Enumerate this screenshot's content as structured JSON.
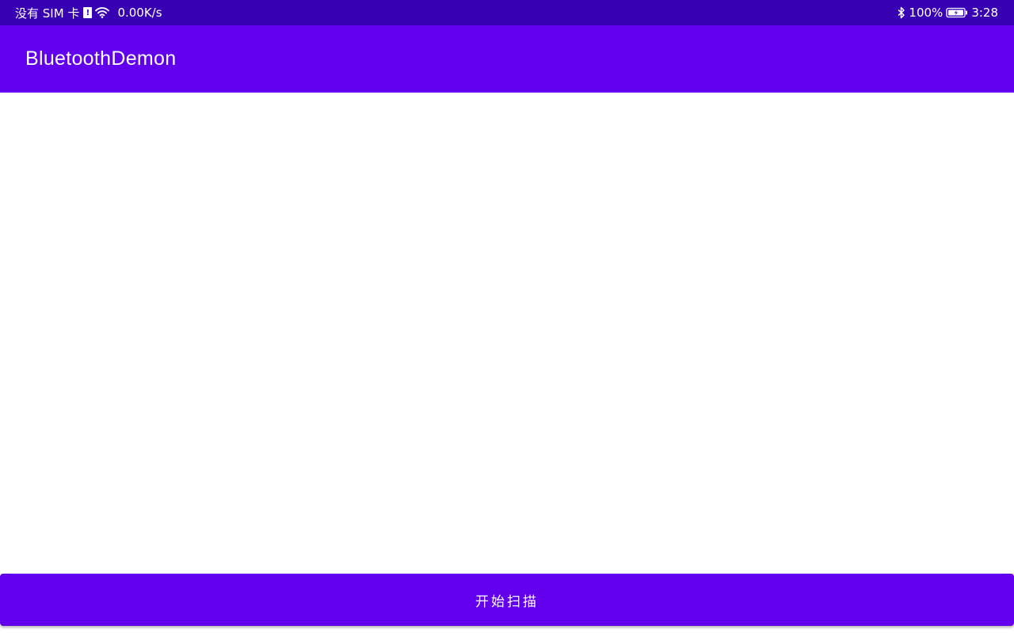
{
  "status_bar": {
    "sim_text": "没有 SIM 卡",
    "sim_alert_glyph": "!",
    "net_speed": "0.00K/s",
    "battery_percent": "100%",
    "time": "3:28",
    "icons": [
      "sim-alert-icon",
      "wifi-icon",
      "bluetooth-icon",
      "battery-charging-icon"
    ]
  },
  "app_bar": {
    "title": "BluetoothDemon"
  },
  "actions": {
    "scan_label": "开始扫描"
  },
  "colors": {
    "status_bar": "#3700b3",
    "primary": "#6200ee",
    "on_primary": "#ffffff",
    "background": "#ffffff"
  }
}
